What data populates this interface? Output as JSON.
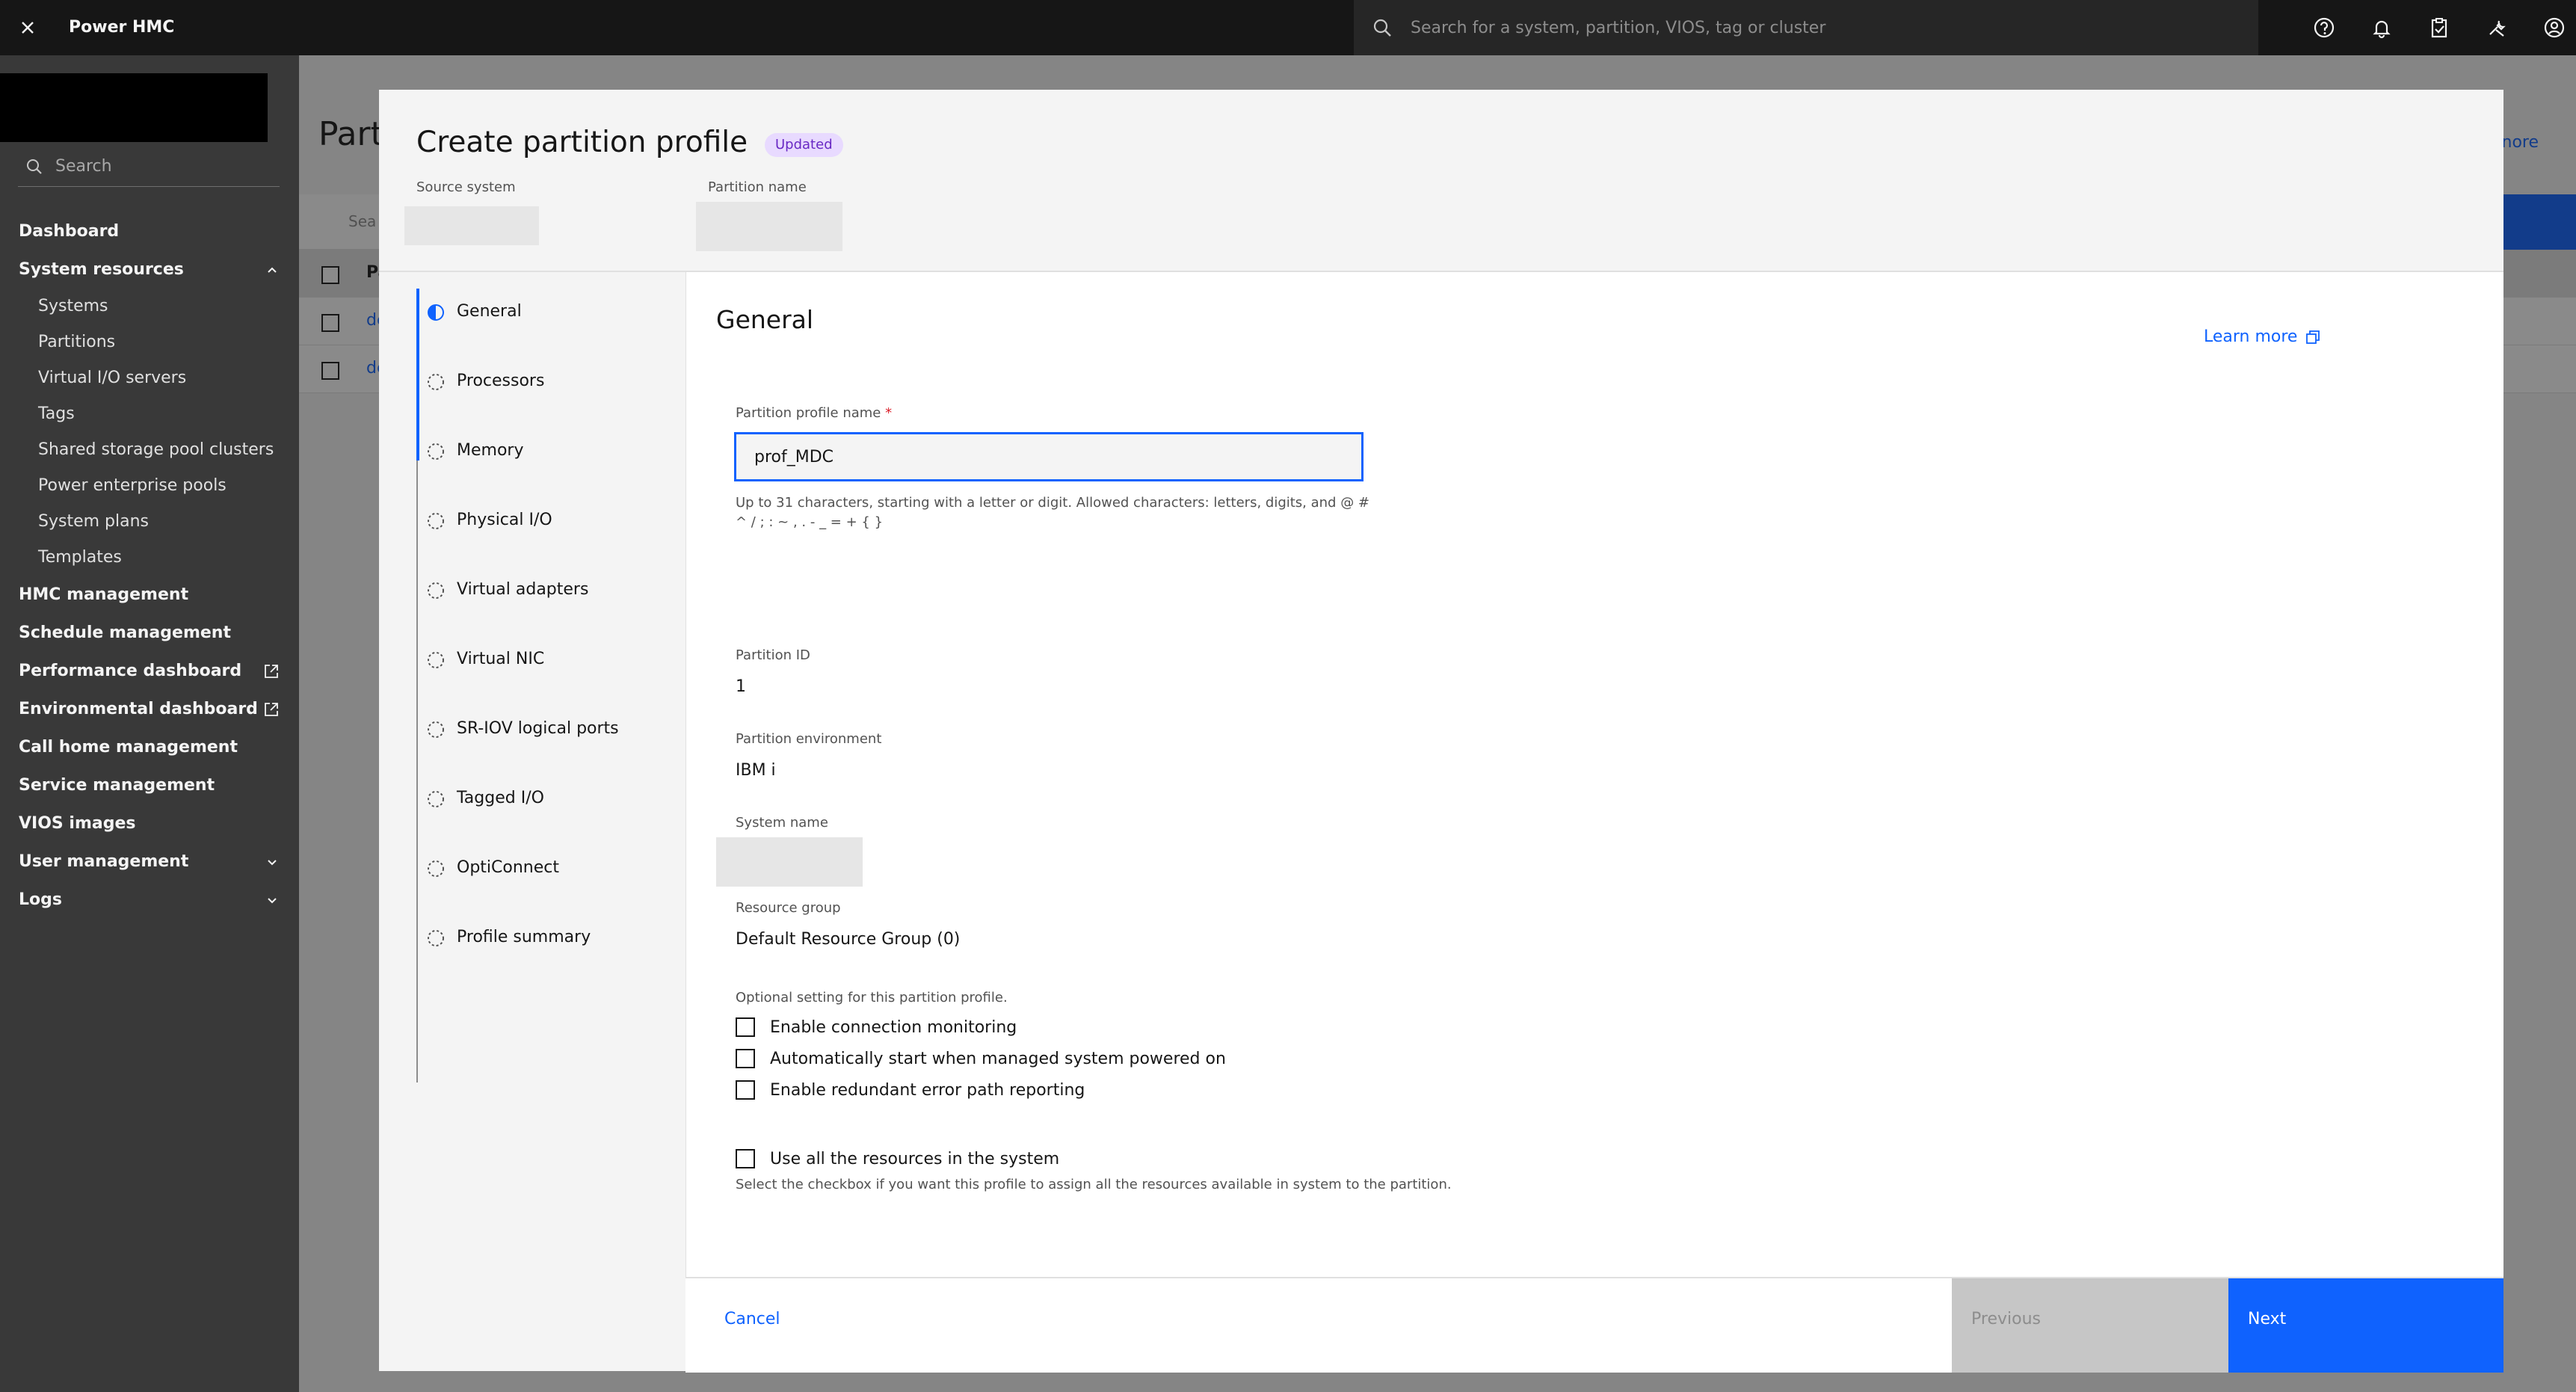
{
  "header": {
    "title": "Power HMC",
    "search_placeholder": "Search for a system, partition, VIOS, tag or cluster",
    "icons": [
      "help-icon",
      "notification-icon",
      "task-clipboard-icon",
      "tools-icon",
      "user-avatar-icon"
    ]
  },
  "sidenav": {
    "search_placeholder": "Search",
    "items": [
      {
        "label": "Dashboard"
      },
      {
        "label": "System resources",
        "expanded": true,
        "children": [
          "Systems",
          "Partitions",
          "Virtual I/O servers",
          "Tags",
          "Shared storage pool clusters",
          "Power enterprise pools",
          "System plans",
          "Templates"
        ]
      },
      {
        "label": "HMC management"
      },
      {
        "label": "Schedule management"
      },
      {
        "label": "Performance dashboard",
        "external": true
      },
      {
        "label": "Environmental dashboard",
        "external": true
      },
      {
        "label": "Call home management"
      },
      {
        "label": "Service management"
      },
      {
        "label": "VIOS images"
      },
      {
        "label": "User management",
        "collapsible": true
      },
      {
        "label": "Logs",
        "collapsible": true
      }
    ]
  },
  "background_page": {
    "title_fragment": "Part",
    "learn_more_fragment": "nore",
    "search_fragment": "Sea",
    "header_fragment": "Pa",
    "row_fragment": "de"
  },
  "modal": {
    "title": "Create partition profile",
    "tag": "Updated",
    "source_system_label": "Source system",
    "source_system_value": "",
    "partition_name_label": "Partition name",
    "steps": [
      {
        "label": "General",
        "state": "current"
      },
      {
        "label": "Processors",
        "state": "incomplete"
      },
      {
        "label": "Memory",
        "state": "incomplete"
      },
      {
        "label": "Physical I/O",
        "state": "incomplete"
      },
      {
        "label": "Virtual adapters",
        "state": "incomplete"
      },
      {
        "label": "Virtual NIC",
        "state": "incomplete"
      },
      {
        "label": "SR-IOV logical ports",
        "state": "incomplete"
      },
      {
        "label": "Tagged I/O",
        "state": "incomplete"
      },
      {
        "label": "OptiConnect",
        "state": "incomplete"
      },
      {
        "label": "Profile summary",
        "state": "incomplete"
      }
    ],
    "content": {
      "heading": "General",
      "learn_more": "Learn more",
      "profile_name_label": "Partition profile name",
      "profile_name_required": "*",
      "profile_name_value": "prof_MDC",
      "profile_name_helper": "Up to 31 characters, starting with a letter or digit. Allowed characters: letters, digits, and @ # ^ / ; : ~ , . - _ = + { }",
      "partition_id_label": "Partition ID",
      "partition_id_value": "1",
      "partition_env_label": "Partition environment",
      "partition_env_value": "IBM i",
      "system_name_label": "System name",
      "resource_group_label": "Resource group",
      "resource_group_value": "Default Resource Group (0)",
      "optional_heading": "Optional setting for this partition profile.",
      "checkboxes": [
        {
          "label": "Enable connection monitoring",
          "checked": false
        },
        {
          "label": "Automatically start when managed system powered on",
          "checked": false
        },
        {
          "label": "Enable redundant error path reporting",
          "checked": false
        }
      ],
      "use_all_label": "Use all the resources in the system",
      "use_all_checked": false,
      "use_all_helper": "Select the checkbox if you want this profile to assign all the resources available in system to the partition."
    },
    "footer": {
      "cancel": "Cancel",
      "previous": "Previous",
      "next": "Next"
    }
  },
  "colors": {
    "primary": "#0f62fe",
    "header_bg": "#161616",
    "nav_bg": "#393939",
    "tag_bg": "#e8daff",
    "tag_fg": "#6929c4",
    "disabled_bg": "#c6c6c6"
  }
}
